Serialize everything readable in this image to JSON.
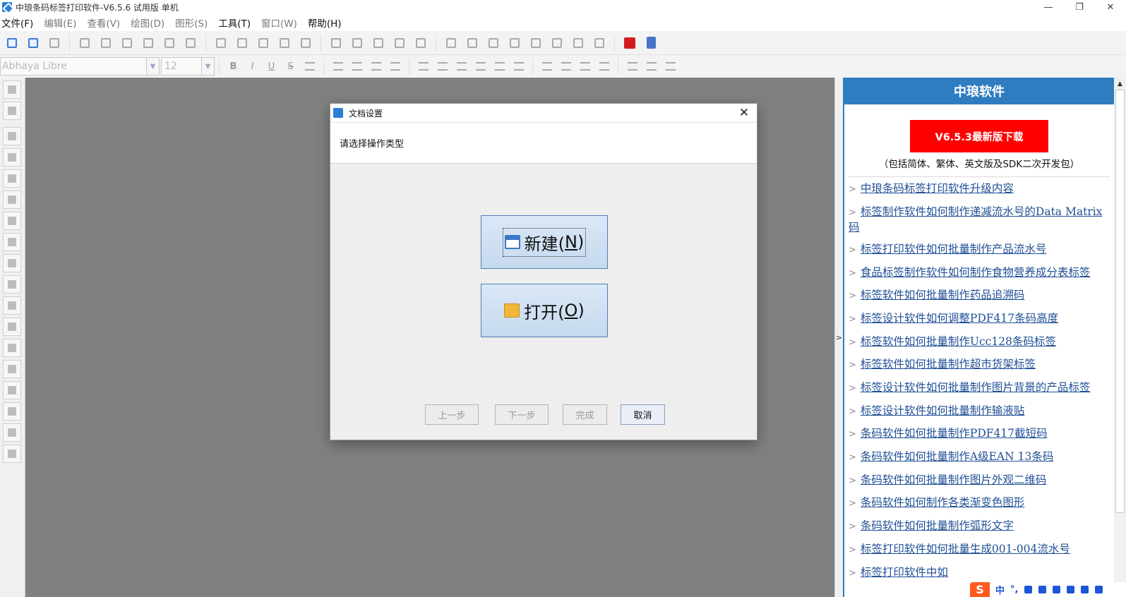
{
  "window": {
    "title": "中琅条码标签打印软件-V6.5.6 试用版 单机",
    "minimize": "—",
    "maximize": "❐",
    "close": "✕"
  },
  "menu": [
    {
      "label": "文件(F)",
      "enabled": true
    },
    {
      "label": "编辑(E)",
      "enabled": false
    },
    {
      "label": "查看(V)",
      "enabled": false
    },
    {
      "label": "绘图(D)",
      "enabled": false
    },
    {
      "label": "图形(S)",
      "enabled": false
    },
    {
      "label": "工具(T)",
      "enabled": true
    },
    {
      "label": "窗口(W)",
      "enabled": false
    },
    {
      "label": "帮助(H)",
      "enabled": true
    }
  ],
  "format_bar": {
    "font_name": "Abhaya Libre",
    "font_size": "12",
    "bold": "B",
    "italic": "I",
    "underline": "U",
    "strike": "S"
  },
  "dialog": {
    "title": "文档设置",
    "close": "✕",
    "prompt": "请选择操作类型",
    "new_label": "新建(",
    "new_key": "N",
    "open_label": "打开(",
    "open_key": "O",
    "paren_close": ")",
    "prev": "上一步",
    "next": "下一步",
    "finish": "完成",
    "cancel": "取消"
  },
  "side_panel": {
    "header": "中琅软件",
    "download": "V6.5.3最新版下载",
    "note": "（包括简体、繁体、英文版及SDK二次开发包）",
    "splitter_arrow": ">",
    "links": [
      "中琅条码标签打印软件升级内容",
      "标签制作软件如何制作递减流水号的Data Matrix码",
      "标签打印软件如何批量制作产品流水号",
      "食品标签制作软件如何制作食物营养成分表标签",
      "标签软件如何批量制作药品追溯码",
      "标签设计软件如何调整PDF417条码高度",
      "标签软件如何批量制作Ucc128条码标签",
      "标签软件如何批量制作超市货架标签",
      "标签设计软件如何批量制作图片背景的产品标签",
      "标签设计软件如何批量制作输液贴",
      "条码软件如何批量制作PDF417截短码",
      "条码软件如何批量制作A级EAN 13条码",
      "条码软件如何批量制作图片外观二维码",
      "条码软件如何制作各类渐变色图形",
      "条码软件如何批量制作弧形文字",
      "标签打印软件如何批量生成001-004流水号",
      "标签打印软件中如"
    ]
  },
  "ime": {
    "logo": "S",
    "mode": "中",
    "punct": "°,"
  }
}
